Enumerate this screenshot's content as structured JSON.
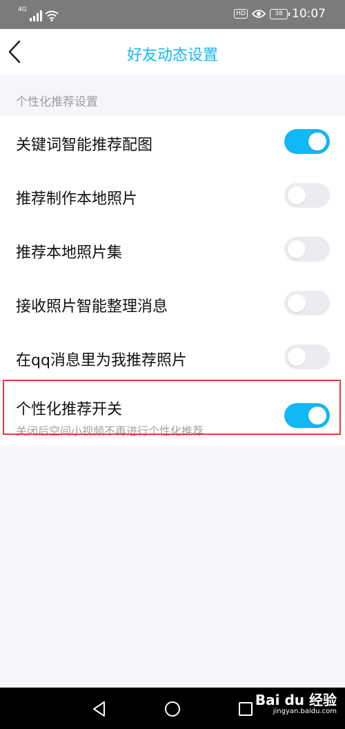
{
  "status_bar": {
    "network": "4G",
    "hd_badge": "HD",
    "battery": "38",
    "time": "10:07"
  },
  "nav": {
    "title": "好友动态设置",
    "back_icon": "chevron-left-icon"
  },
  "section_header": "个性化推荐设置",
  "settings": [
    {
      "label": "关键词智能推荐配图",
      "on": true
    },
    {
      "label": "推荐制作本地照片",
      "on": false
    },
    {
      "label": "推荐本地照片集",
      "on": false
    },
    {
      "label": "接收照片智能整理消息",
      "on": false
    },
    {
      "label": "在qq消息里为我推荐照片",
      "on": false
    },
    {
      "label": "个性化推荐开关",
      "subtitle": "关闭后空间小视频不再进行个性化推荐",
      "on": true
    }
  ],
  "colors": {
    "accent": "#12b7f5",
    "toggle_off": "#ebecf0",
    "highlight": "#e43b3b"
  },
  "watermark": {
    "logo": "Bai du 经验",
    "url": "jingyan.baidu.com"
  }
}
